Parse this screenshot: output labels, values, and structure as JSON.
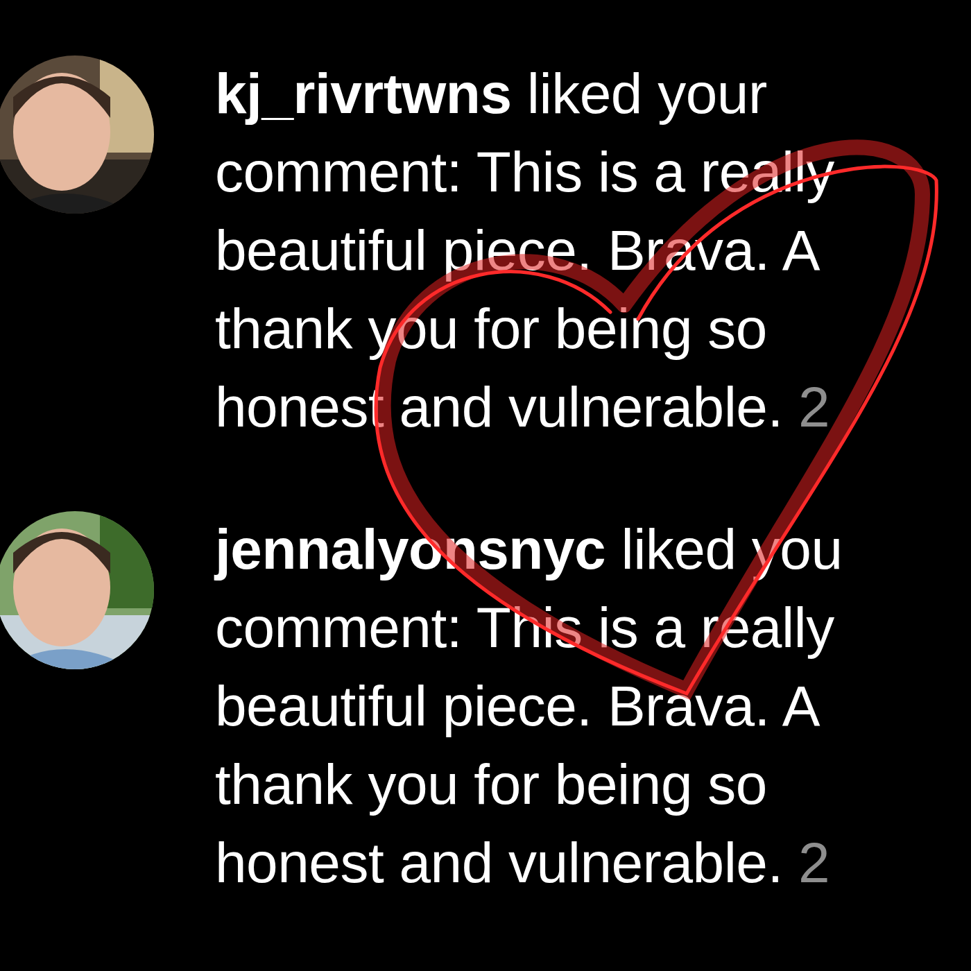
{
  "notifications": [
    {
      "username": "kj_rivrtwns",
      "lines": [
        "liked your",
        "comment: This is a really",
        "beautiful piece. Brava. A",
        "thank you for being so",
        "honest and vulnerable."
      ],
      "time": "2"
    },
    {
      "username": "jennalyonsnyc",
      "lines": [
        "liked you",
        "comment: This is a really",
        "beautiful piece. Brava. A",
        "thank you for being so",
        "honest and vulnerable."
      ],
      "time": "2"
    }
  ]
}
